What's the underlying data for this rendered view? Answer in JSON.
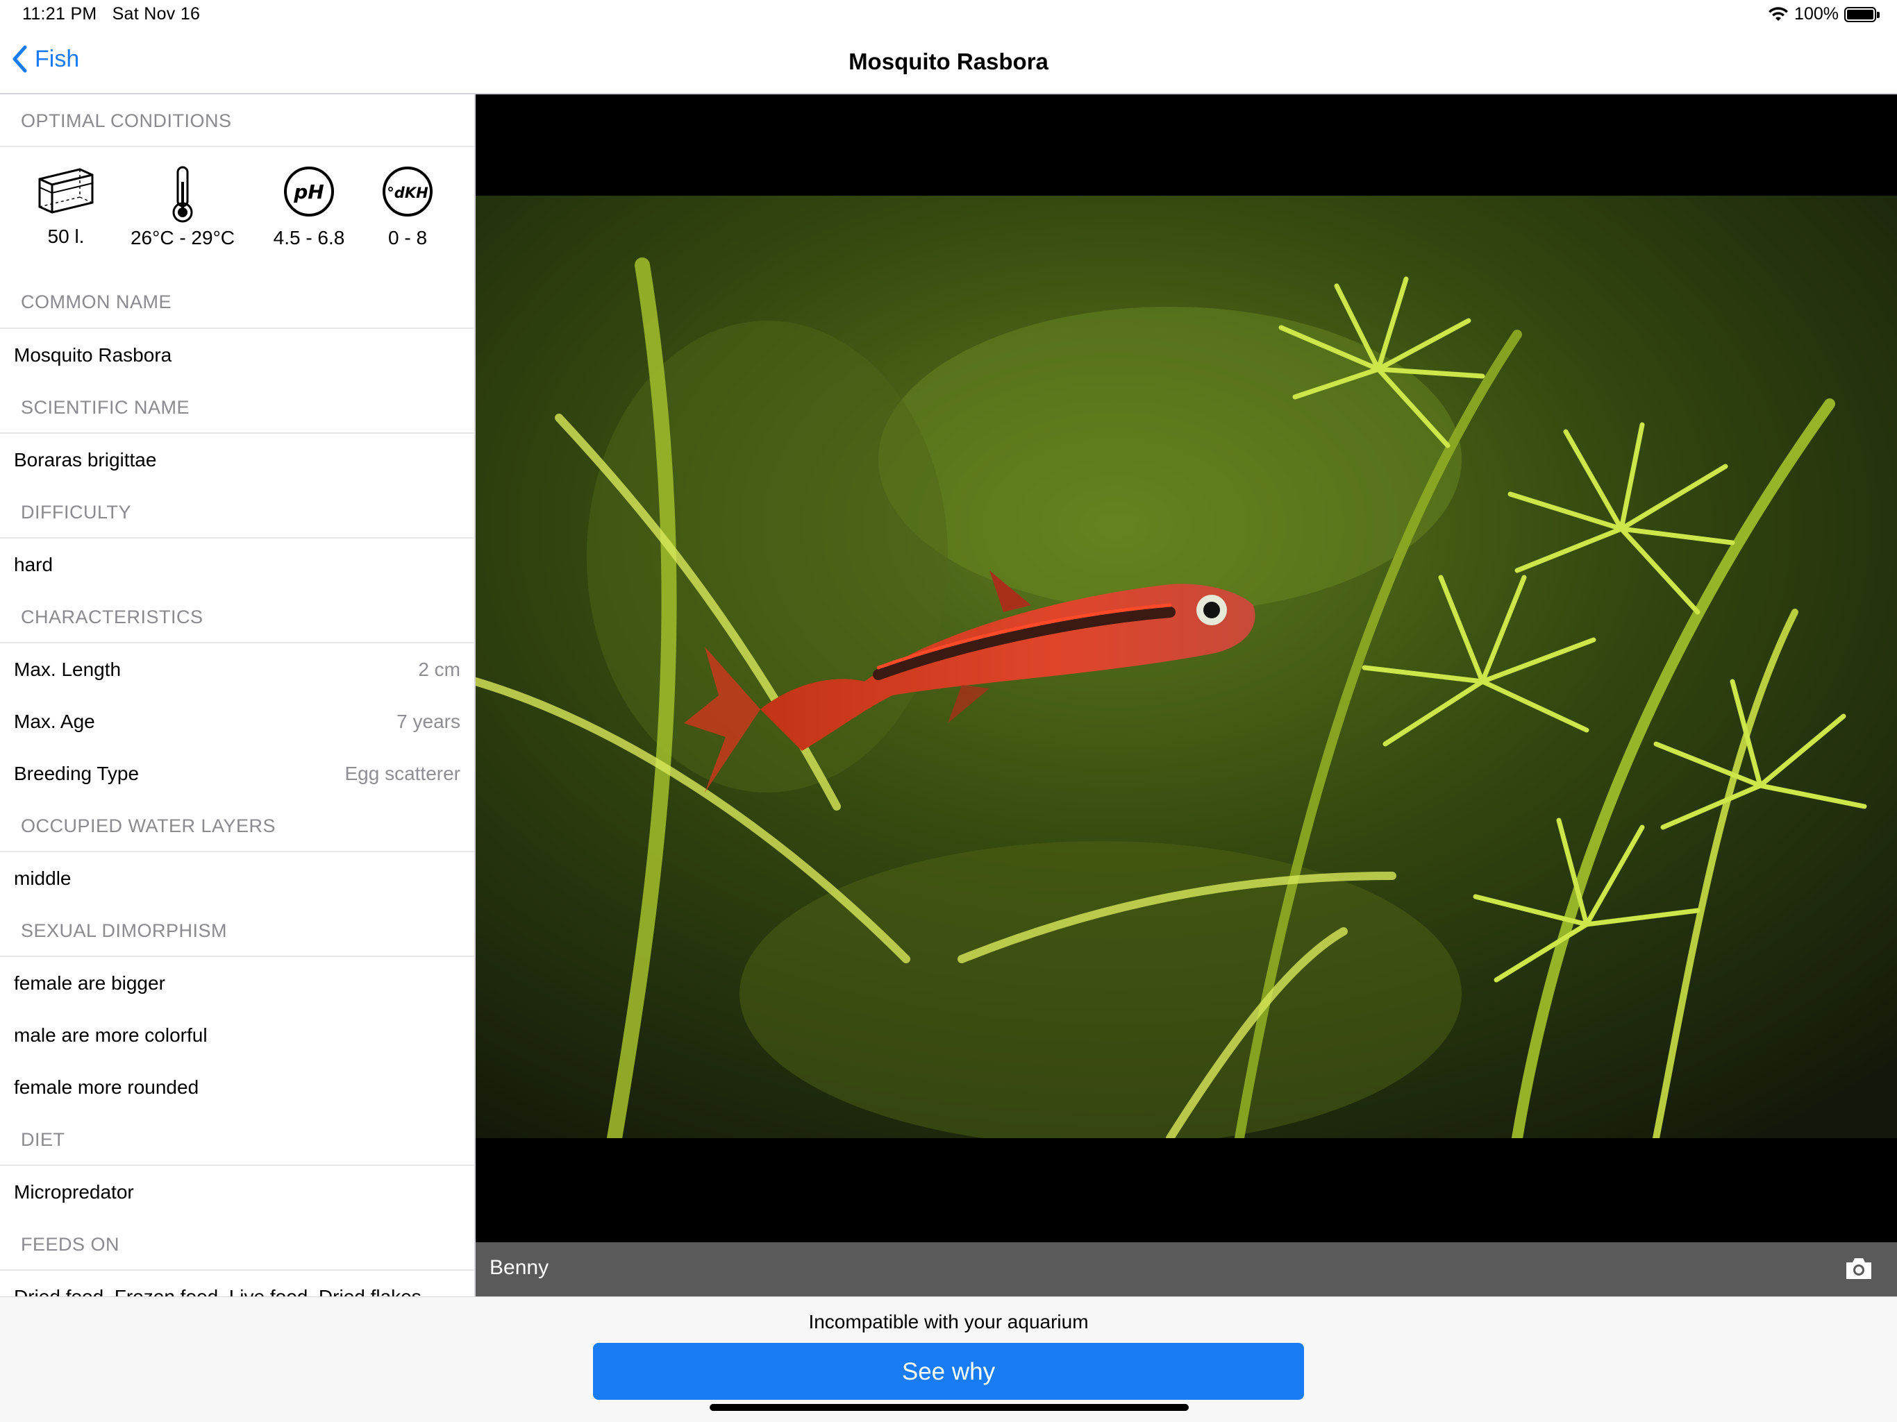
{
  "status": {
    "time": "11:21 PM",
    "date": "Sat Nov 16",
    "battery": "100%"
  },
  "nav": {
    "back_label": "Fish",
    "title": "Mosquito Rasbora"
  },
  "sidebar": {
    "optimal_header": "OPTIMAL CONDITIONS",
    "conditions": [
      {
        "icon": "tank-icon",
        "label": "50 l."
      },
      {
        "icon": "thermometer-icon",
        "label": "26°C - 29°C"
      },
      {
        "icon": "ph-icon",
        "label": "4.5 - 6.8",
        "icon_text": "pH"
      },
      {
        "icon": "dkh-icon",
        "label": "0 - 8",
        "icon_text": "°dKH"
      }
    ],
    "common_name_header": "COMMON NAME",
    "common_name": "Mosquito Rasbora",
    "scientific_name_header": "SCIENTIFIC NAME",
    "scientific_name": "Boraras brigittae",
    "difficulty_header": "DIFFICULTY",
    "difficulty": "hard",
    "characteristics_header": "CHARACTERISTICS",
    "characteristics": [
      {
        "label": "Max. Length",
        "value": "2 cm"
      },
      {
        "label": "Max. Age",
        "value": "7 years"
      },
      {
        "label": "Breeding Type",
        "value": "Egg scatterer"
      }
    ],
    "water_layers_header": "OCCUPIED WATER LAYERS",
    "water_layers": "middle",
    "dimorphism_header": "SEXUAL DIMORPHISM",
    "dimorphism": [
      "female are bigger",
      "male are more colorful",
      "female more rounded"
    ],
    "diet_header": "DIET",
    "diet": "Micropredator",
    "feeds_on_header": "FEEDS ON",
    "feeds_on": "Dried food, Frozen food, Live food, Dried flakes"
  },
  "photo": {
    "caption": "Benny",
    "camera_icon": "camera-icon"
  },
  "footer": {
    "message": "Incompatible with your aquarium",
    "button_label": "See why"
  },
  "colors": {
    "accent": "#1a7cf5",
    "secondary_text": "#8e8e93",
    "caption_bar": "#5a5a5a"
  }
}
